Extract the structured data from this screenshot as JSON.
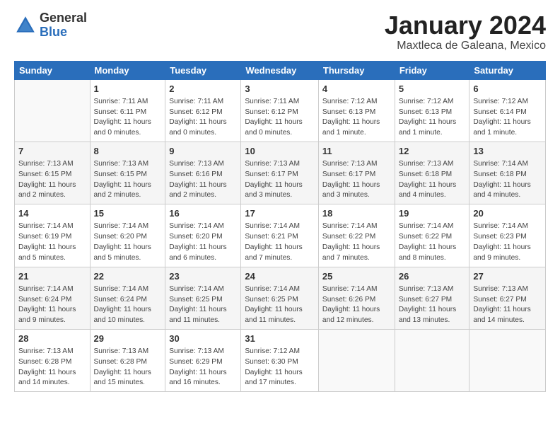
{
  "header": {
    "logo_general": "General",
    "logo_blue": "Blue",
    "month_title": "January 2024",
    "location": "Maxtleca de Galeana, Mexico"
  },
  "weekdays": [
    "Sunday",
    "Monday",
    "Tuesday",
    "Wednesday",
    "Thursday",
    "Friday",
    "Saturday"
  ],
  "weeks": [
    [
      {
        "day": "",
        "sunrise": "",
        "sunset": "",
        "daylight": ""
      },
      {
        "day": "1",
        "sunrise": "Sunrise: 7:11 AM",
        "sunset": "Sunset: 6:11 PM",
        "daylight": "Daylight: 11 hours and 0 minutes."
      },
      {
        "day": "2",
        "sunrise": "Sunrise: 7:11 AM",
        "sunset": "Sunset: 6:12 PM",
        "daylight": "Daylight: 11 hours and 0 minutes."
      },
      {
        "day": "3",
        "sunrise": "Sunrise: 7:11 AM",
        "sunset": "Sunset: 6:12 PM",
        "daylight": "Daylight: 11 hours and 0 minutes."
      },
      {
        "day": "4",
        "sunrise": "Sunrise: 7:12 AM",
        "sunset": "Sunset: 6:13 PM",
        "daylight": "Daylight: 11 hours and 1 minute."
      },
      {
        "day": "5",
        "sunrise": "Sunrise: 7:12 AM",
        "sunset": "Sunset: 6:13 PM",
        "daylight": "Daylight: 11 hours and 1 minute."
      },
      {
        "day": "6",
        "sunrise": "Sunrise: 7:12 AM",
        "sunset": "Sunset: 6:14 PM",
        "daylight": "Daylight: 11 hours and 1 minute."
      }
    ],
    [
      {
        "day": "7",
        "sunrise": "Sunrise: 7:13 AM",
        "sunset": "Sunset: 6:15 PM",
        "daylight": "Daylight: 11 hours and 2 minutes."
      },
      {
        "day": "8",
        "sunrise": "Sunrise: 7:13 AM",
        "sunset": "Sunset: 6:15 PM",
        "daylight": "Daylight: 11 hours and 2 minutes."
      },
      {
        "day": "9",
        "sunrise": "Sunrise: 7:13 AM",
        "sunset": "Sunset: 6:16 PM",
        "daylight": "Daylight: 11 hours and 2 minutes."
      },
      {
        "day": "10",
        "sunrise": "Sunrise: 7:13 AM",
        "sunset": "Sunset: 6:17 PM",
        "daylight": "Daylight: 11 hours and 3 minutes."
      },
      {
        "day": "11",
        "sunrise": "Sunrise: 7:13 AM",
        "sunset": "Sunset: 6:17 PM",
        "daylight": "Daylight: 11 hours and 3 minutes."
      },
      {
        "day": "12",
        "sunrise": "Sunrise: 7:13 AM",
        "sunset": "Sunset: 6:18 PM",
        "daylight": "Daylight: 11 hours and 4 minutes."
      },
      {
        "day": "13",
        "sunrise": "Sunrise: 7:14 AM",
        "sunset": "Sunset: 6:18 PM",
        "daylight": "Daylight: 11 hours and 4 minutes."
      }
    ],
    [
      {
        "day": "14",
        "sunrise": "Sunrise: 7:14 AM",
        "sunset": "Sunset: 6:19 PM",
        "daylight": "Daylight: 11 hours and 5 minutes."
      },
      {
        "day": "15",
        "sunrise": "Sunrise: 7:14 AM",
        "sunset": "Sunset: 6:20 PM",
        "daylight": "Daylight: 11 hours and 5 minutes."
      },
      {
        "day": "16",
        "sunrise": "Sunrise: 7:14 AM",
        "sunset": "Sunset: 6:20 PM",
        "daylight": "Daylight: 11 hours and 6 minutes."
      },
      {
        "day": "17",
        "sunrise": "Sunrise: 7:14 AM",
        "sunset": "Sunset: 6:21 PM",
        "daylight": "Daylight: 11 hours and 7 minutes."
      },
      {
        "day": "18",
        "sunrise": "Sunrise: 7:14 AM",
        "sunset": "Sunset: 6:22 PM",
        "daylight": "Daylight: 11 hours and 7 minutes."
      },
      {
        "day": "19",
        "sunrise": "Sunrise: 7:14 AM",
        "sunset": "Sunset: 6:22 PM",
        "daylight": "Daylight: 11 hours and 8 minutes."
      },
      {
        "day": "20",
        "sunrise": "Sunrise: 7:14 AM",
        "sunset": "Sunset: 6:23 PM",
        "daylight": "Daylight: 11 hours and 9 minutes."
      }
    ],
    [
      {
        "day": "21",
        "sunrise": "Sunrise: 7:14 AM",
        "sunset": "Sunset: 6:24 PM",
        "daylight": "Daylight: 11 hours and 9 minutes."
      },
      {
        "day": "22",
        "sunrise": "Sunrise: 7:14 AM",
        "sunset": "Sunset: 6:24 PM",
        "daylight": "Daylight: 11 hours and 10 minutes."
      },
      {
        "day": "23",
        "sunrise": "Sunrise: 7:14 AM",
        "sunset": "Sunset: 6:25 PM",
        "daylight": "Daylight: 11 hours and 11 minutes."
      },
      {
        "day": "24",
        "sunrise": "Sunrise: 7:14 AM",
        "sunset": "Sunset: 6:25 PM",
        "daylight": "Daylight: 11 hours and 11 minutes."
      },
      {
        "day": "25",
        "sunrise": "Sunrise: 7:14 AM",
        "sunset": "Sunset: 6:26 PM",
        "daylight": "Daylight: 11 hours and 12 minutes."
      },
      {
        "day": "26",
        "sunrise": "Sunrise: 7:13 AM",
        "sunset": "Sunset: 6:27 PM",
        "daylight": "Daylight: 11 hours and 13 minutes."
      },
      {
        "day": "27",
        "sunrise": "Sunrise: 7:13 AM",
        "sunset": "Sunset: 6:27 PM",
        "daylight": "Daylight: 11 hours and 14 minutes."
      }
    ],
    [
      {
        "day": "28",
        "sunrise": "Sunrise: 7:13 AM",
        "sunset": "Sunset: 6:28 PM",
        "daylight": "Daylight: 11 hours and 14 minutes."
      },
      {
        "day": "29",
        "sunrise": "Sunrise: 7:13 AM",
        "sunset": "Sunset: 6:28 PM",
        "daylight": "Daylight: 11 hours and 15 minutes."
      },
      {
        "day": "30",
        "sunrise": "Sunrise: 7:13 AM",
        "sunset": "Sunset: 6:29 PM",
        "daylight": "Daylight: 11 hours and 16 minutes."
      },
      {
        "day": "31",
        "sunrise": "Sunrise: 7:12 AM",
        "sunset": "Sunset: 6:30 PM",
        "daylight": "Daylight: 11 hours and 17 minutes."
      },
      {
        "day": "",
        "sunrise": "",
        "sunset": "",
        "daylight": ""
      },
      {
        "day": "",
        "sunrise": "",
        "sunset": "",
        "daylight": ""
      },
      {
        "day": "",
        "sunrise": "",
        "sunset": "",
        "daylight": ""
      }
    ]
  ]
}
